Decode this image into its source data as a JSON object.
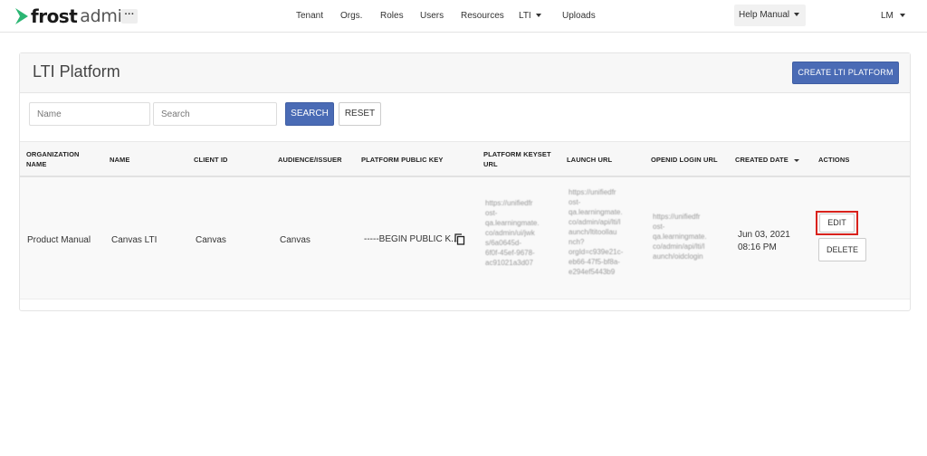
{
  "app": {
    "logo_word": "frost",
    "logo_suffix": "admin",
    "logo_icon": "chevron-arrow-icon",
    "more_label": "···"
  },
  "nav": {
    "items": [
      "Tenant",
      "Orgs.",
      "Roles",
      "Users",
      "Resources",
      "LTI",
      "Uploads"
    ],
    "help_label": "Help Manual",
    "user_initials": "LM"
  },
  "page": {
    "title": "LTI Platform",
    "create_label": "CREATE LTI PLATFORM"
  },
  "filters": {
    "name_placeholder": "Name",
    "search_placeholder": "Search",
    "search_label": "SEARCH",
    "reset_label": "RESET"
  },
  "table": {
    "columns": [
      "ORGANIZATION NAME",
      "NAME",
      "CLIENT ID",
      "AUDIENCE/ISSUER",
      "PLATFORM PUBLIC KEY",
      "PLATFORM KEYSET URL",
      "LAUNCH URL",
      "OPENID LOGIN URL",
      "CREATED DATE",
      "ACTIONS"
    ],
    "rows": [
      {
        "organization": "Product Manual",
        "name": "Canvas LTI",
        "client_id": "Canvas",
        "audience": "Canvas",
        "public_key": "-----BEGIN PUBLIC K...",
        "keyset_url_lines": [
          "https://unifiedfr",
          "ost-",
          "qa.learningmate.",
          "co/admin/ui/jwk",
          "s/6a0645d-",
          "6f0f-45ef-9678-",
          "ac91021a3d07"
        ],
        "launch_url_lines": [
          "https://unifiedfr",
          "ost-",
          "qa.learningmate.",
          "co/admin/api/lti/l",
          "aunch/ltitoollau",
          "nch?",
          "orgId=c939e21c-",
          "eb66-47f5-bf8a-",
          "e294ef5443b9"
        ],
        "openid_url_lines": [
          "https://unifiedfr",
          "ost-",
          "qa.learningmate.",
          "co/admin/api/lti/l",
          "aunch/oidclogin"
        ],
        "created_date": "Jun 03, 2021",
        "created_time": "08:16 PM",
        "edit_label": "EDIT",
        "delete_label": "DELETE"
      }
    ]
  },
  "colors": {
    "primary": "#4a6bb5",
    "logo_green": "#2bb673",
    "highlight": "#d9221c"
  }
}
